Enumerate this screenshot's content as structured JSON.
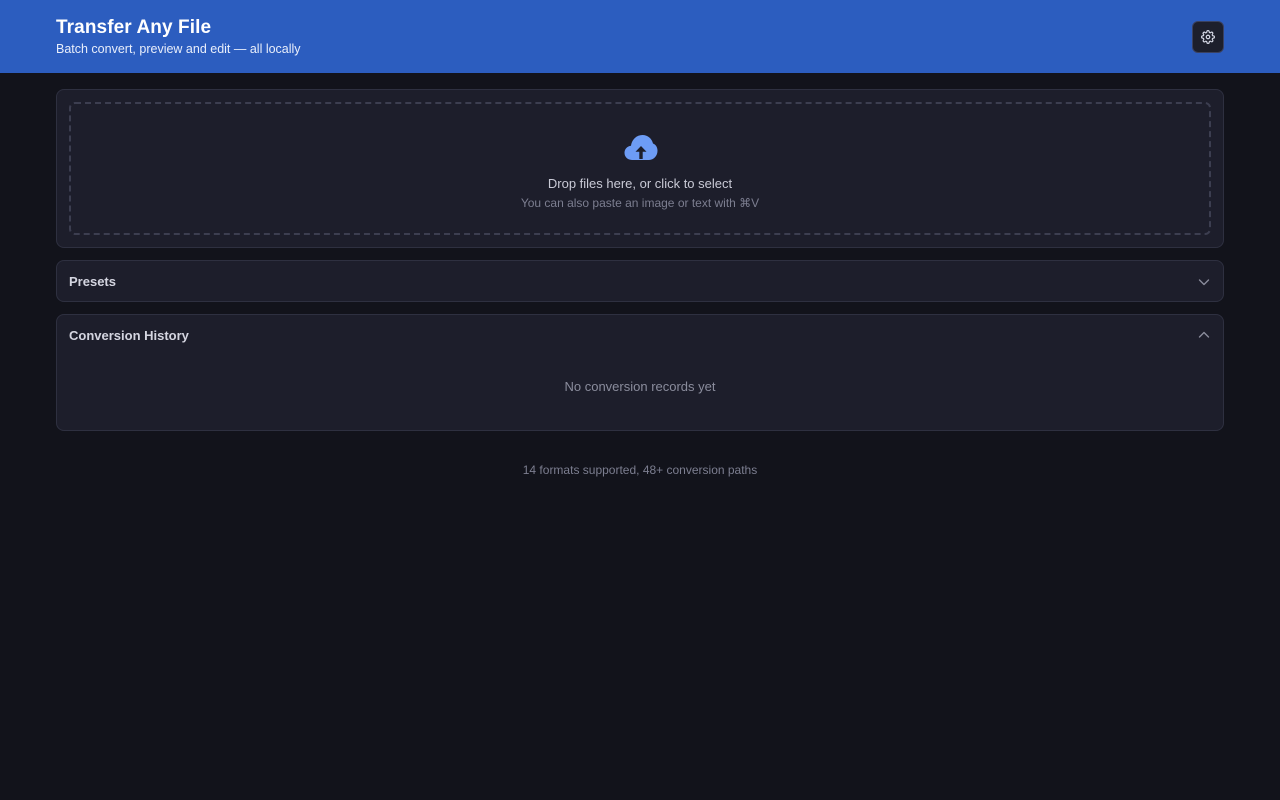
{
  "header": {
    "title": "Transfer Any File",
    "subtitle": "Batch convert, preview and edit — all locally",
    "settings_icon": "gear-icon"
  },
  "dropzone": {
    "icon": "cloud-upload-icon",
    "primary_text": "Drop files here, or click to select",
    "secondary_text": "You can also paste an image or text with ⌘V"
  },
  "presets": {
    "title": "Presets",
    "icon": "chevron-down-icon"
  },
  "history": {
    "title": "Conversion History",
    "icon": "chevron-up-icon",
    "empty_text": "No conversion records yet"
  },
  "footer": {
    "text": "14 formats supported, 48+ conversion paths"
  },
  "colors": {
    "header_bg": "#2c5dbf",
    "page_bg": "#12131b",
    "card_bg": "#1d1e2b",
    "accent_icon": "#6d9cf5"
  }
}
